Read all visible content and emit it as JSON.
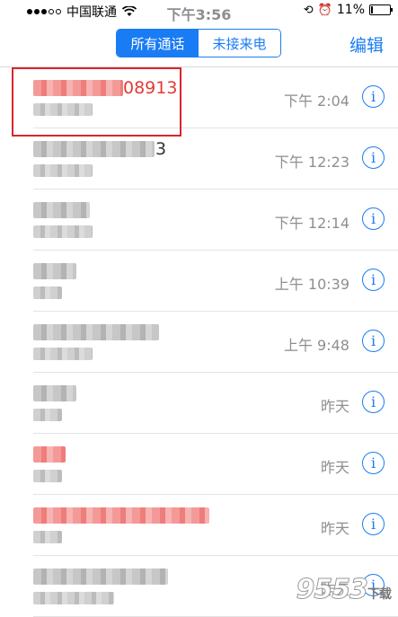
{
  "status_bar": {
    "carrier": "中国联通",
    "time": "下午3:56",
    "battery": "11%",
    "battery_level": 0.11
  },
  "nav": {
    "segment_all": "所有通话",
    "segment_missed": "未接来电",
    "edit": "编辑"
  },
  "calls": [
    {
      "name": "08913",
      "time": "下午 2:04",
      "missed": true
    },
    {
      "name": "3",
      "time": "下午 12:23",
      "missed": false
    },
    {
      "name": "",
      "time": "下午 12:14",
      "missed": false
    },
    {
      "name": "",
      "time": "上午 10:39",
      "missed": false
    },
    {
      "name": "",
      "time": "上午 9:48",
      "missed": false
    },
    {
      "name": "",
      "time": "昨天",
      "missed": false
    },
    {
      "name": "",
      "time": "昨天",
      "missed": true
    },
    {
      "name": "",
      "time": "昨天",
      "missed": true
    },
    {
      "name": "",
      "time": "昨天",
      "missed": false
    }
  ],
  "watermark": {
    "text": "9553",
    "sub": "下载"
  },
  "icons": {
    "info": "info-icon",
    "wifi": "wifi-icon",
    "alarm": "alarm-icon",
    "lock": "orientation-lock-icon"
  },
  "colors": {
    "accent": "#1a7cf5",
    "missed": "#e53935",
    "highlight": "#d8262b"
  }
}
